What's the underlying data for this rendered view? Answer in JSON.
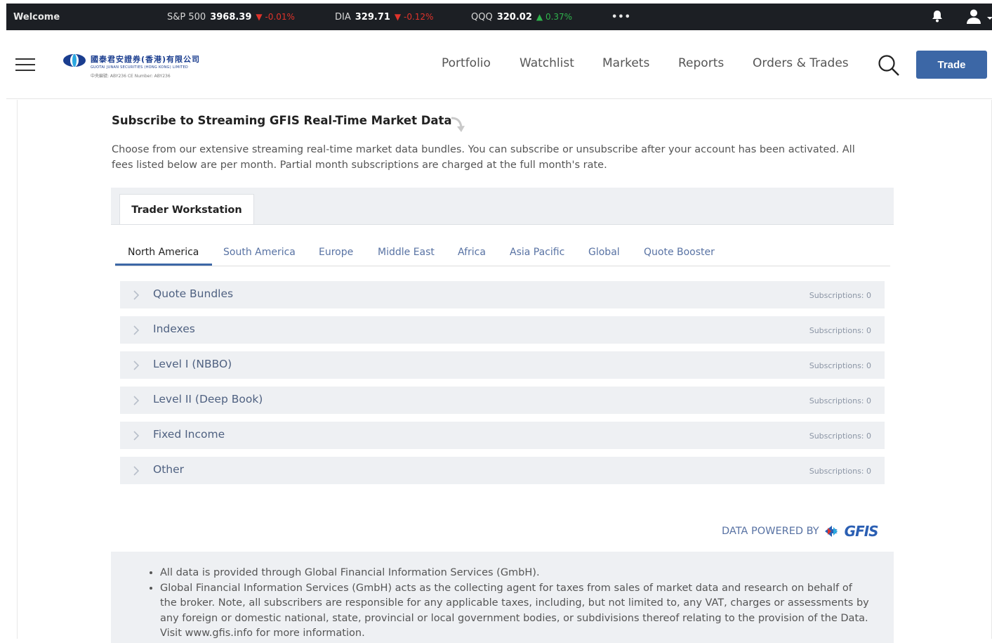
{
  "ticker": {
    "welcome": "Welcome",
    "items": [
      {
        "symbol": "S&P 500",
        "price": "3968.39",
        "change": "0.01%",
        "direction": "down",
        "arrow": "▼"
      },
      {
        "symbol": "DIA",
        "price": "329.71",
        "change": "0.12%",
        "direction": "down",
        "arrow": "▼"
      },
      {
        "symbol": "QQQ",
        "price": "320.02",
        "change": "0.37%",
        "direction": "up",
        "arrow": "▲"
      }
    ],
    "more": "•••",
    "icons": [
      "bell-icon",
      "user-icon",
      "caret-down-icon"
    ]
  },
  "header": {
    "logo": {
      "cn": "國泰君安證券(香港)有限公司",
      "en": "GUOTAI JUNAN SECURITIES (HONG KONG) LIMITED",
      "license": "中央編號: ABY236  CE Number: ABY236"
    },
    "nav": [
      "Portfolio",
      "Watchlist",
      "Markets",
      "Reports",
      "Orders & Trades"
    ],
    "trade_label": "Trade"
  },
  "main": {
    "title": "Subscribe to Streaming GFIS Real-Time Market Data",
    "description": "Choose from our extensive streaming real-time market data bundles. You can subscribe or unsubscribe after your account has been activated. All fees listed below are per month. Partial month subscriptions are charged at the full month's rate.",
    "platform_tab": "Trader Workstation",
    "region_tabs": [
      "North America",
      "South America",
      "Europe",
      "Middle East",
      "Africa",
      "Asia Pacific",
      "Global",
      "Quote Booster"
    ],
    "active_region": "North America",
    "sections": [
      {
        "label": "Quote Bundles",
        "subscriptions": "Subscriptions: 0"
      },
      {
        "label": "Indexes",
        "subscriptions": "Subscriptions: 0"
      },
      {
        "label": "Level I (NBBO)",
        "subscriptions": "Subscriptions: 0"
      },
      {
        "label": "Level II (Deep Book)",
        "subscriptions": "Subscriptions: 0"
      },
      {
        "label": "Fixed Income",
        "subscriptions": "Subscriptions: 0"
      },
      {
        "label": "Other",
        "subscriptions": "Subscriptions: 0"
      }
    ],
    "powered_by": "DATA POWERED BY",
    "powered_brand": "GFIS",
    "notes": [
      "All data is provided through Global Financial Information Services (GmbH).",
      "Global Financial Information Services (GmbH) acts as the collecting agent for taxes from sales of market data and research on behalf of the broker. Note, all subscribers are responsible for any applicable taxes, including, but not limited to, any VAT, charges or assessments by any foreign or domestic national, state, provincial or local government bodies, or subdivisions thereof relating to the provision of the Data. Visit www.gfis.info for more information."
    ]
  },
  "colors": {
    "accent": "#3c67a6",
    "ticker_bg": "#1c1f24",
    "down": "#e0332b",
    "up": "#2fb24c",
    "panel_bg": "#eef0f3",
    "link": "#5872a3"
  }
}
